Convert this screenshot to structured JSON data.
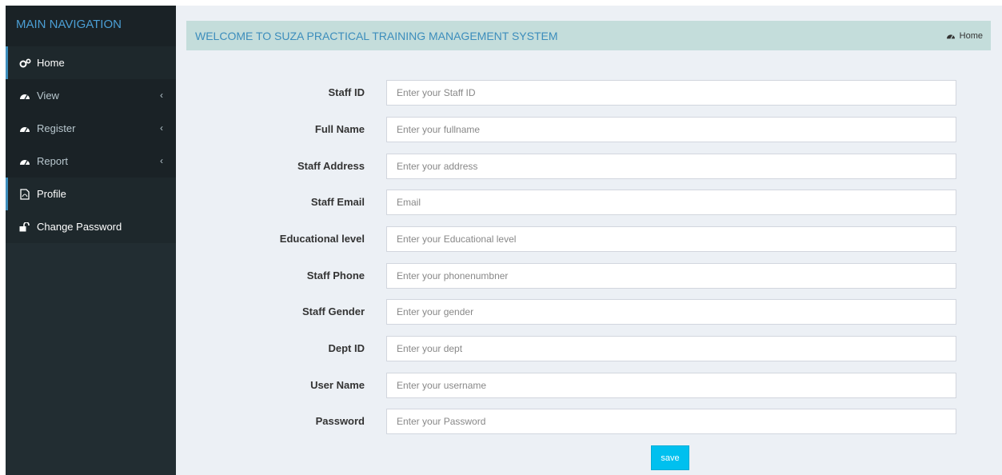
{
  "sidebar": {
    "header": "MAIN NAVIGATION",
    "items": [
      {
        "label": "Home",
        "icon": "cogs-icon"
      },
      {
        "label": "View",
        "icon": "dashboard-icon",
        "chevron": "‹"
      },
      {
        "label": "Register",
        "icon": "dashboard-icon",
        "chevron": "‹"
      },
      {
        "label": "Report",
        "icon": "dashboard-icon",
        "chevron": "‹"
      },
      {
        "label": "Profile",
        "icon": "file-pdf-icon"
      },
      {
        "label": "Change Password",
        "icon": "unlock-icon"
      }
    ]
  },
  "banner": {
    "title": "WELCOME TO SUZA PRACTICAL TRAINING MANAGEMENT SYSTEM",
    "home_label": "Home"
  },
  "form": {
    "fields": [
      {
        "label": "Staff ID",
        "placeholder": "Enter your Staff ID"
      },
      {
        "label": "Full Name",
        "placeholder": "Enter your fullname"
      },
      {
        "label": "Staff Address",
        "placeholder": "Enter your address"
      },
      {
        "label": "Staff Email",
        "placeholder": "Email"
      },
      {
        "label": "Educational level",
        "placeholder": "Enter your Educational level"
      },
      {
        "label": "Staff Phone",
        "placeholder": "Enter your phonenumbner"
      },
      {
        "label": "Staff Gender",
        "placeholder": "Enter your gender"
      },
      {
        "label": "Dept ID",
        "placeholder": "Enter your dept"
      },
      {
        "label": "User Name",
        "placeholder": "Enter your username"
      },
      {
        "label": "Password",
        "placeholder": "Enter your Password"
      }
    ],
    "save_label": "save"
  },
  "colors": {
    "sidebar_bg": "#222d32",
    "accent": "#3c8dbc",
    "banner_bg": "#c4dddb",
    "button": "#00c0ef"
  }
}
